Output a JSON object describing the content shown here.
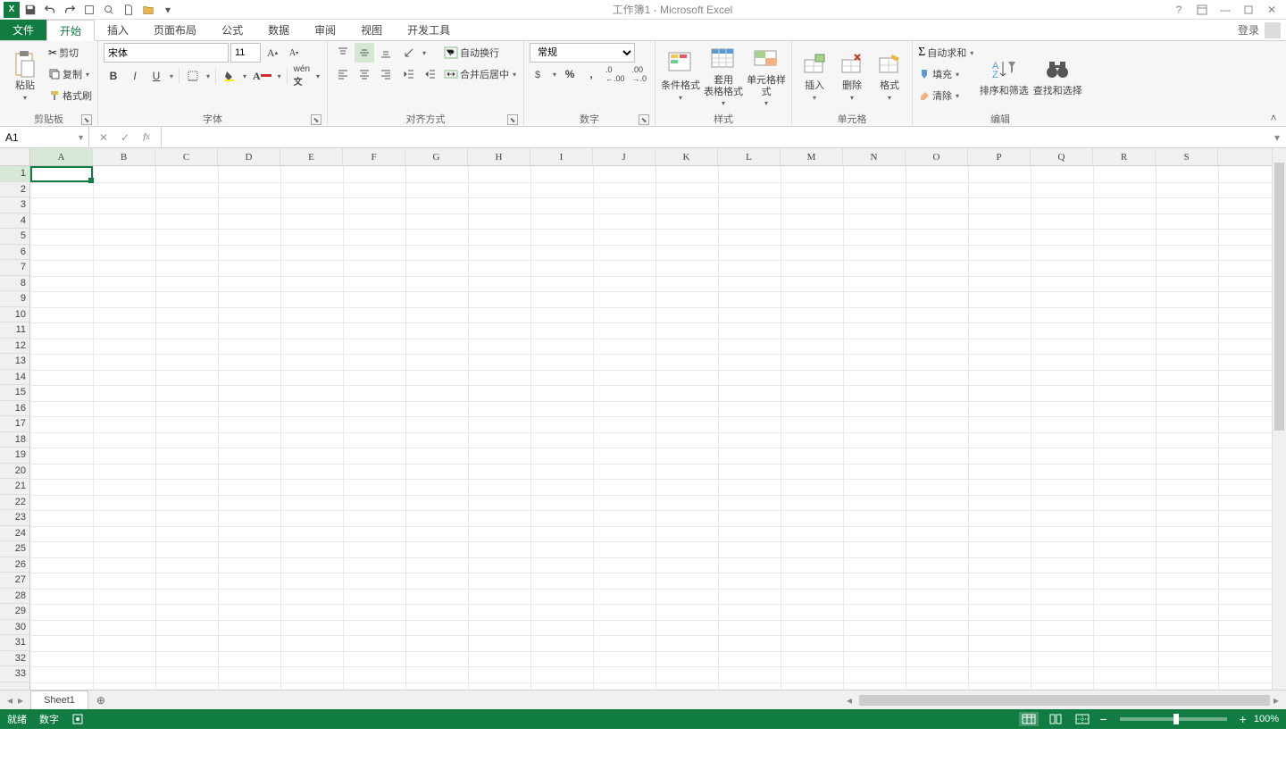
{
  "app": {
    "title": "工作簿1 - Microsoft Excel"
  },
  "tabs": {
    "file": "文件",
    "items": [
      "开始",
      "插入",
      "页面布局",
      "公式",
      "数据",
      "审阅",
      "视图",
      "开发工具"
    ],
    "active": 0,
    "login": "登录"
  },
  "ribbon": {
    "clipboard": {
      "label": "剪贴板",
      "paste": "粘贴",
      "cut": "剪切",
      "copy": "复制",
      "format_painter": "格式刷"
    },
    "font": {
      "label": "字体",
      "name": "宋体",
      "size": "11"
    },
    "align": {
      "label": "对齐方式",
      "wrap": "自动换行",
      "merge": "合并后居中"
    },
    "number": {
      "label": "数字",
      "format": "常规"
    },
    "styles": {
      "label": "样式",
      "cond": "条件格式",
      "table": "套用\n表格格式",
      "cell": "单元格样式"
    },
    "cells_g": {
      "label": "单元格",
      "insert": "插入",
      "delete": "删除",
      "format": "格式"
    },
    "editing": {
      "label": "编辑",
      "autosum": "自动求和",
      "fill": "填充",
      "clear": "清除",
      "sort": "排序和筛选",
      "find": "查找和选择"
    }
  },
  "formula": {
    "cell_ref": "A1",
    "value": ""
  },
  "grid": {
    "columns": [
      "A",
      "B",
      "C",
      "D",
      "E",
      "F",
      "G",
      "H",
      "I",
      "J",
      "K",
      "L",
      "M",
      "N",
      "O",
      "P",
      "Q",
      "R",
      "S"
    ],
    "row_count": 33,
    "active": {
      "col": 0,
      "row": 0
    }
  },
  "sheets": {
    "active": "Sheet1"
  },
  "status": {
    "ready": "就绪",
    "mode": "数字",
    "zoom": "100%"
  }
}
